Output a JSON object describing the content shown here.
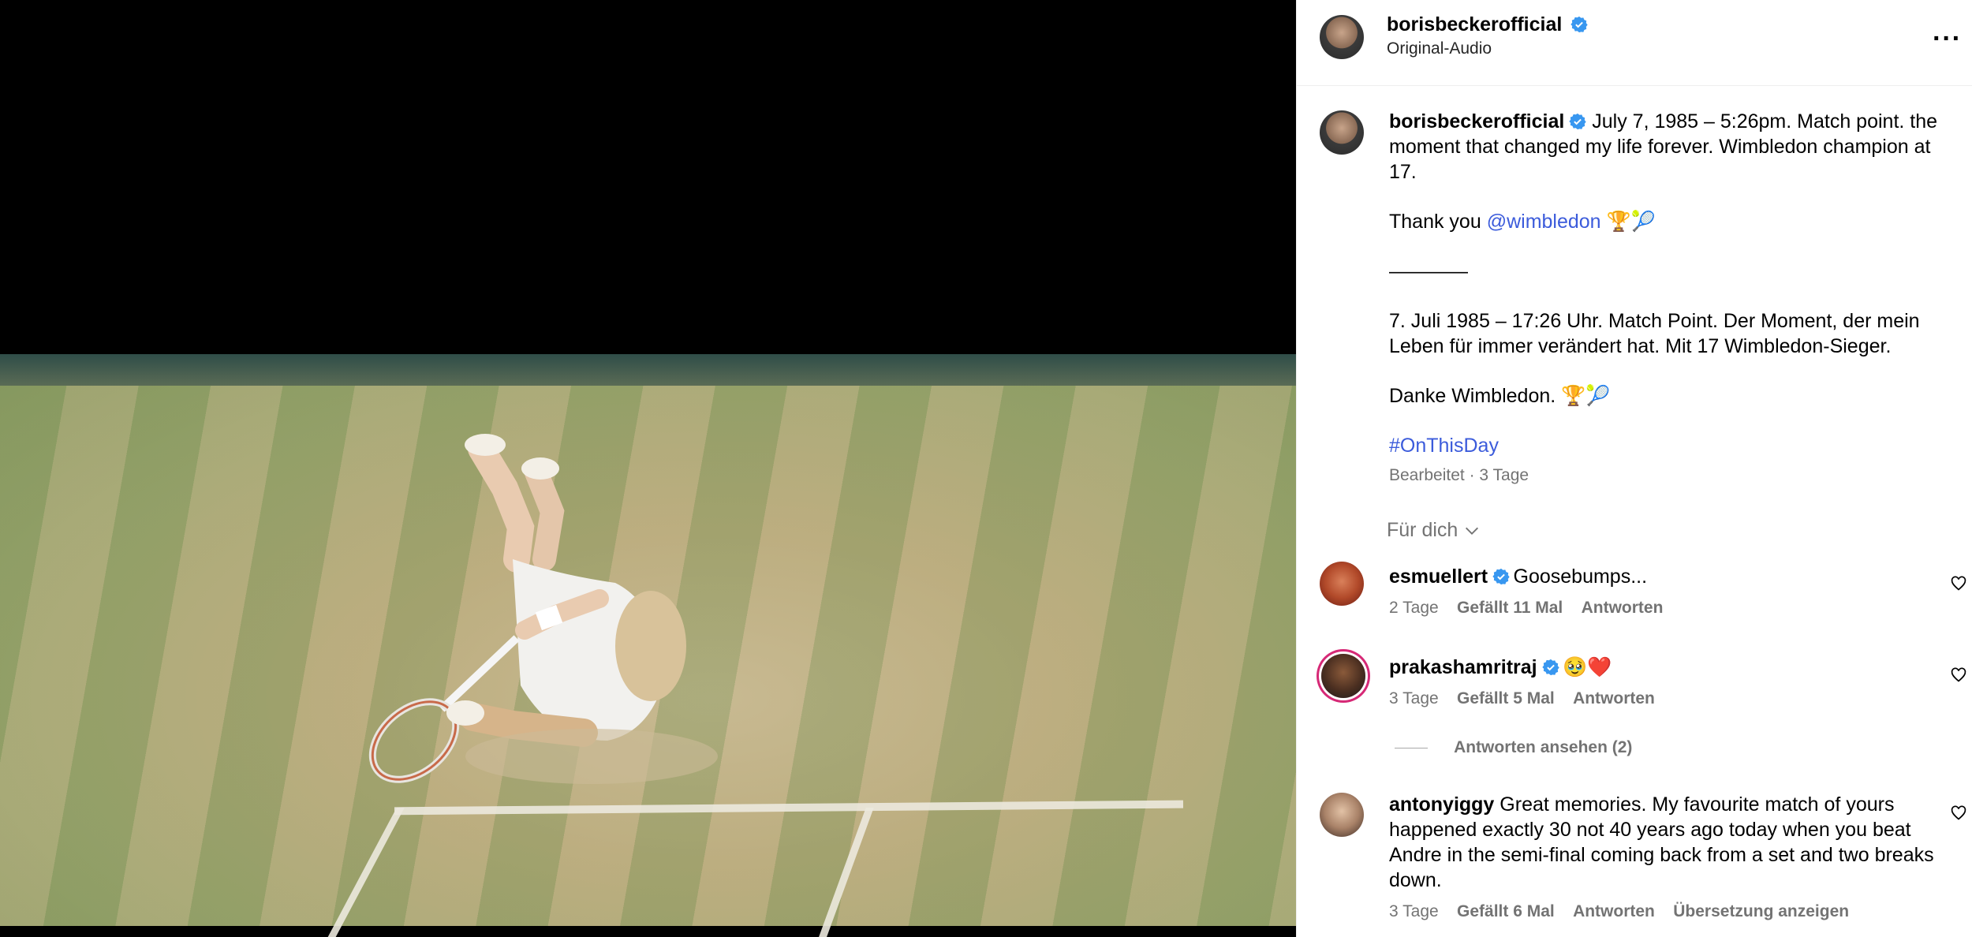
{
  "post": {
    "author": "borisbeckerofficial",
    "audio": "Original-Audio",
    "more_label": "···",
    "caption": {
      "lines": [
        "July 7, 1985 – 5:26pm. Match point. the moment that changed my life forever. Wimbledon champion at 17.",
        "Thank you",
        "@wimbledon",
        "🏆🎾",
        "————",
        "7. Juli 1985 – 17:26 Uhr. Match Point. Der Moment, der mein Leben für immer verändert hat. Mit 17 Wimbledon-Sieger.",
        "Danke Wimbledon.",
        "🏆🎾",
        "#OnThisDay"
      ],
      "edited": "Bearbeitet · 3 Tage"
    },
    "filter_label": "Für dich"
  },
  "comments": [
    {
      "user": "esmuellert",
      "verified": true,
      "text": "Goosebumps...",
      "age": "2 Tage",
      "likes": "Gefällt 11 Mal",
      "reply": "Antworten"
    },
    {
      "user": "prakashamritraj",
      "verified": true,
      "text": "🥹❤️",
      "age": "3 Tage",
      "likes": "Gefällt 5 Mal",
      "reply": "Antworten",
      "view_replies": "Antworten ansehen (2)"
    },
    {
      "user": "antonyiggy",
      "verified": false,
      "text": "Great memories. My favourite match of yours happened exactly 30 not 40 years ago today when you beat Andre in the semi-final coming back from a set and two breaks down.",
      "age": "3 Tage",
      "likes": "Gefällt 6 Mal",
      "reply": "Antworten",
      "translate": "Übersetzung anzeigen"
    }
  ],
  "colors": {
    "link": "#3b5bdb",
    "verified": "#3897f0",
    "muted": "#737373"
  }
}
